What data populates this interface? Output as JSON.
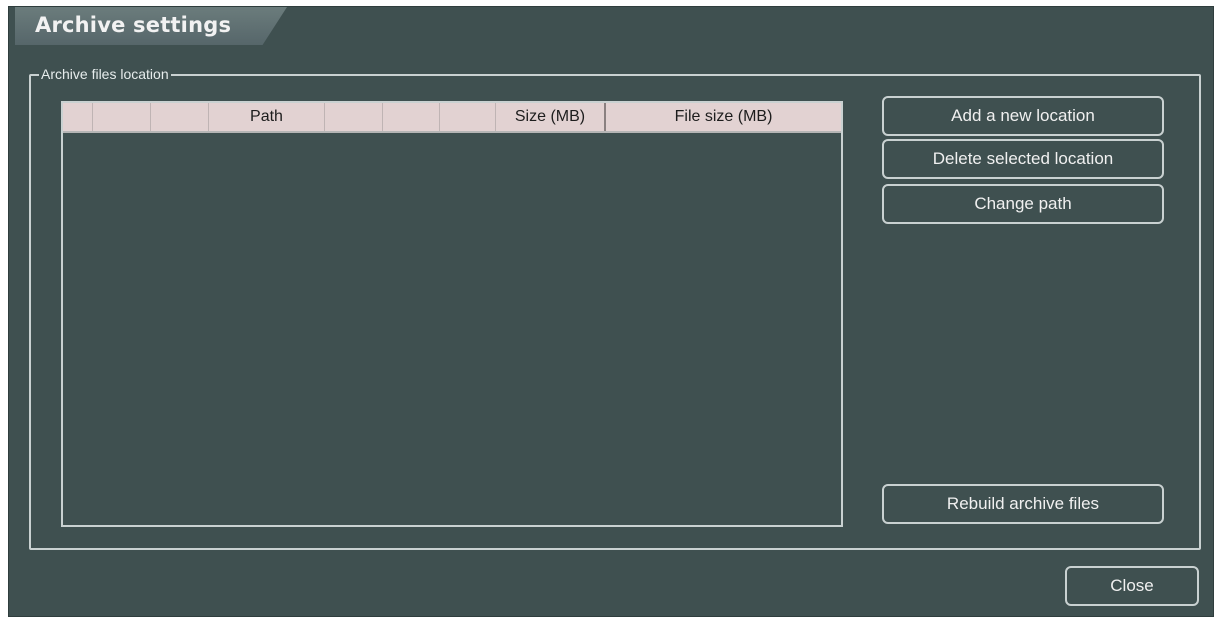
{
  "window": {
    "title": "Archive settings"
  },
  "group": {
    "label": "Archive files location"
  },
  "table": {
    "columns": [
      "Path",
      "Size (MB)",
      "File size (MB)"
    ],
    "rows": []
  },
  "buttons": {
    "add_location": "Add a new location",
    "delete_location": "Delete selected location",
    "change_path": "Change path",
    "rebuild": "Rebuild archive files",
    "close": "Close"
  },
  "colors": {
    "background": "#3f5050",
    "header": "#e2d2d2",
    "border": "#c9d1d1"
  }
}
